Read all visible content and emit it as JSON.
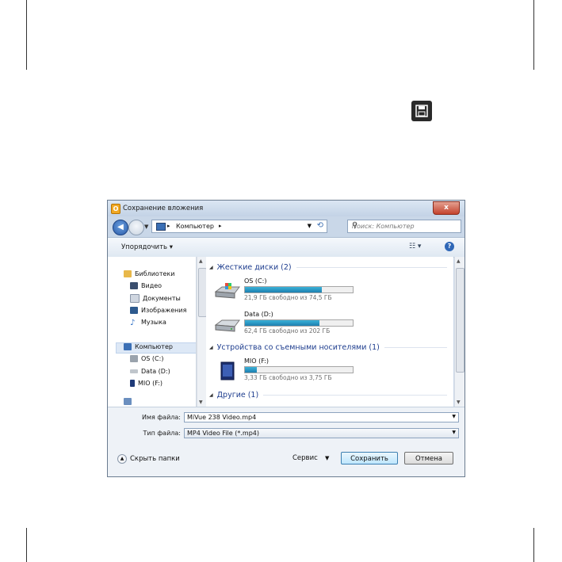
{
  "dialog": {
    "title": "Сохранение вложения",
    "close_label": "x",
    "app_icon_letter": "O"
  },
  "nav": {
    "breadcrumb": "Компьютер",
    "search_placeholder": "Поиск: Компьютер"
  },
  "toolbar": {
    "organize_label": "Упорядочить ▾",
    "help_label": "?"
  },
  "sidebar": {
    "items": [
      {
        "label": "Библиотеки"
      },
      {
        "label": "Видео"
      },
      {
        "label": "Документы"
      },
      {
        "label": "Изображения"
      },
      {
        "label": "Музыка"
      },
      {
        "label": "Компьютер"
      },
      {
        "label": "OS (C:)"
      },
      {
        "label": "Data (D:)"
      },
      {
        "label": "MIO (F:)"
      }
    ]
  },
  "content": {
    "groups": [
      {
        "header": "Жесткие диски (2)"
      },
      {
        "header": "Устройства со съемными носителями (1)"
      },
      {
        "header": "Другие (1)"
      }
    ],
    "drives": [
      {
        "name": "OS (C:)",
        "info": "21,9 ГБ свободно из 74,5 ГБ",
        "used_fraction": 0.71
      },
      {
        "name": "Data (D:)",
        "info": "62,4 ГБ свободно из 202 ГБ",
        "used_fraction": 0.69
      },
      {
        "name": "MIO (F:)",
        "info": "3,33 ГБ свободно из 3,75 ГБ",
        "used_fraction": 0.11
      }
    ]
  },
  "form": {
    "filename_label": "Имя файла:",
    "filename_value": "MiVue 238 Video.mp4",
    "filetype_label": "Тип файла:",
    "filetype_value": "MP4 Video File (*.mp4)"
  },
  "footer": {
    "hide_folders_label": "Скрыть папки",
    "service_label": "Сервис",
    "save_label": "Сохранить",
    "cancel_label": "Отмена"
  },
  "colors": {
    "accent": "#1e7fb0",
    "group_header": "#1e3d8e",
    "close_button": "#c4422d"
  }
}
